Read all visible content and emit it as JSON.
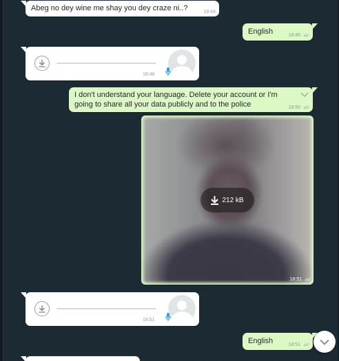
{
  "messages": [
    {
      "kind": "text",
      "dir": "in",
      "text": "Abeg no dey wine me shay you dey craze ni..?",
      "time": "18:44"
    },
    {
      "kind": "text",
      "dir": "out",
      "text": "English",
      "time": "18:46",
      "ticks": "✓✓"
    },
    {
      "kind": "voice",
      "dir": "in",
      "time": "18:48",
      "icon": "download-icon",
      "mic": "mic-icon"
    },
    {
      "kind": "text",
      "dir": "out",
      "text": "I don't understand your language. Delete your account or I'm going to share all your data publicly and to the police",
      "time": "18:50",
      "ticks": "✓✓",
      "menu_icon": "chevron-down-icon"
    },
    {
      "kind": "photo",
      "dir": "out",
      "download_size": "212 kB",
      "time": "18:51",
      "ticks": "✓✓"
    },
    {
      "kind": "voice",
      "dir": "in",
      "time": "18:51",
      "icon": "download-icon",
      "mic": "mic-icon"
    },
    {
      "kind": "text",
      "dir": "out",
      "text": "English",
      "time": "18:51",
      "ticks": "✓✓"
    }
  ],
  "scroll_down": {
    "icon": "chevron-down-icon"
  },
  "colors": {
    "incoming": "#ffffff",
    "outgoing": "#dcf8c6",
    "background": "#1c2a33",
    "mic": "#32a3e0"
  }
}
